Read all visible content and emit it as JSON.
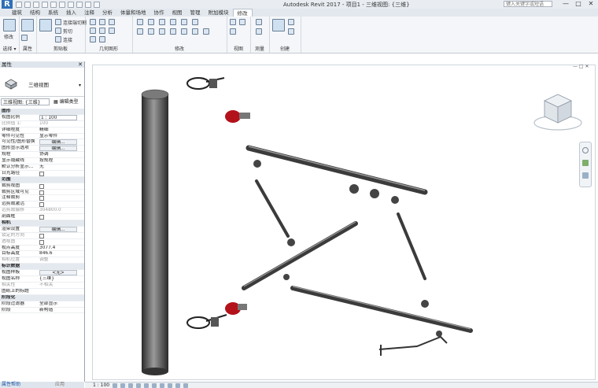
{
  "titlebar": {
    "logo": "R",
    "title": "Autodesk Revit 2017 -    项目1 - 三维视图: {三维}",
    "search_placeholder": "键入关键字或短语",
    "controls": [
      "—",
      "□",
      "✕"
    ]
  },
  "tabs": [
    "建筑",
    "结构",
    "系统",
    "插入",
    "注释",
    "分析",
    "体量和场地",
    "协作",
    "视图",
    "管理",
    "附加模块",
    "修改"
  ],
  "active_tab": "修改",
  "ribbon": {
    "modify_label": "修改",
    "select_label": "选择 ▾",
    "properties_label": "属性",
    "clipboard_label": "剪贴板",
    "geometry_label": "几何图形",
    "modify_panel_label": "修改",
    "view_label": "视图",
    "measure_label": "测量",
    "create_label": "创建",
    "clipboard_items": [
      "连接端切割",
      "剪切",
      "连接"
    ]
  },
  "properties": {
    "title": "属性",
    "close": "✕",
    "type_name": "三维视图",
    "view_select": "三维视图: {三维}",
    "edit_type": "编辑类型",
    "rows": [
      {
        "name": "图形",
        "group": true
      },
      {
        "name": "视图比例",
        "value": "1 : 100",
        "kind": "input"
      },
      {
        "name": "比例值 1:",
        "value": "100",
        "dim": true
      },
      {
        "name": "详细程度",
        "value": "精细"
      },
      {
        "name": "零件可见性",
        "value": "显示零件"
      },
      {
        "name": "可见性/图形替换",
        "value": "编辑...",
        "kind": "btn"
      },
      {
        "name": "图形显示选项",
        "value": "编辑...",
        "kind": "btn"
      },
      {
        "name": "规程",
        "value": "协调"
      },
      {
        "name": "显示隐藏线",
        "value": "按规程"
      },
      {
        "name": "默认分析显示...",
        "value": "无"
      },
      {
        "name": "日光路径",
        "kind": "box"
      },
      {
        "name": "范围",
        "group": true
      },
      {
        "name": "裁剪视图",
        "kind": "box"
      },
      {
        "name": "裁剪区域可见",
        "kind": "box"
      },
      {
        "name": "注释裁剪",
        "kind": "box"
      },
      {
        "name": "远剪裁激活",
        "kind": "box"
      },
      {
        "name": "远剪裁偏移",
        "value": "304800.0",
        "dim": true
      },
      {
        "name": "剖面框",
        "kind": "box"
      },
      {
        "name": "相机",
        "group": true
      },
      {
        "name": "渲染设置",
        "value": "编辑...",
        "kind": "btn"
      },
      {
        "name": "锁定的方向",
        "kind": "box",
        "dim": true
      },
      {
        "name": "透视图",
        "kind": "box",
        "dim": true
      },
      {
        "name": "视点高度",
        "value": "3077.4"
      },
      {
        "name": "目标高度",
        "value": "846.6"
      },
      {
        "name": "相机位置",
        "value": "调整",
        "dim": true
      },
      {
        "name": "标识数据",
        "group": true
      },
      {
        "name": "视图样板",
        "value": "<无>",
        "kind": "btn"
      },
      {
        "name": "视图名称",
        "value": "{三维}"
      },
      {
        "name": "相关性",
        "value": "不相关",
        "dim": true
      },
      {
        "name": "图纸上的标题",
        "value": ""
      },
      {
        "name": "阶段化",
        "group": true
      },
      {
        "name": "阶段过滤器",
        "value": "全部显示"
      },
      {
        "name": "阶段",
        "value": "新构造"
      }
    ],
    "help_link": "属性帮助",
    "apply": "应用"
  },
  "viewbar": {
    "scale": "1 : 100"
  },
  "colors": {
    "pipe": "#3d3d3d",
    "valve_red": "#b3121b",
    "selection_blue": "#2f6fb5"
  }
}
